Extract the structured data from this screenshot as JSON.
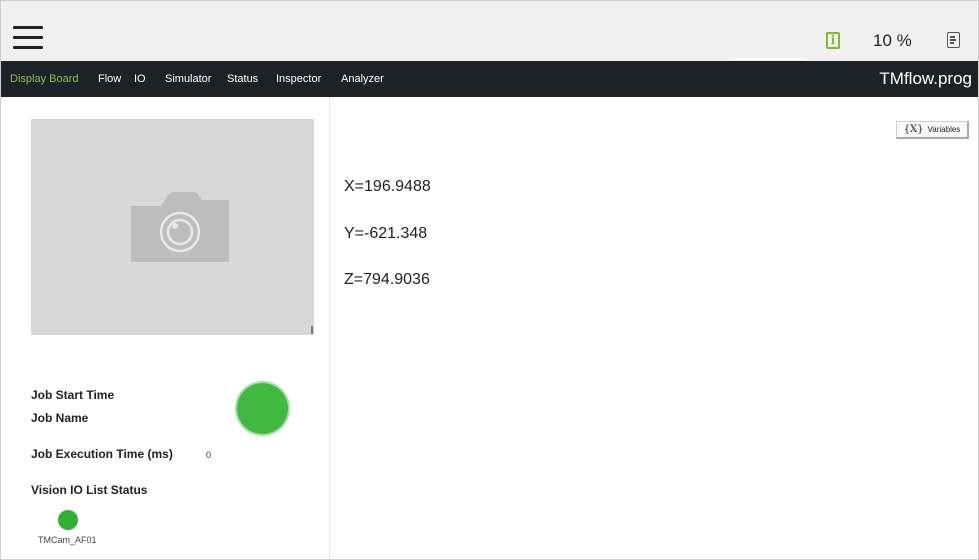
{
  "header": {
    "speed_percent": "10 %",
    "info_icon": "info-icon",
    "log_icon": "document-icon"
  },
  "nav": {
    "tabs": [
      {
        "label": "Display Board",
        "active": true
      },
      {
        "label": "Flow",
        "active": false
      },
      {
        "label": "IO",
        "active": false
      },
      {
        "label": "Simulator",
        "active": false
      },
      {
        "label": "Status",
        "active": false
      },
      {
        "label": "Inspector",
        "active": false
      },
      {
        "label": "Analyzer",
        "active": false
      }
    ],
    "file_name": "TMflow.prog"
  },
  "job": {
    "start_time_label": "Job Start Time",
    "name_label": "Job Name",
    "execution_time_label": "Job Execution Time (ms)",
    "execution_time_value": "0",
    "io_list_label": "Vision IO List Status",
    "io_device_name": "TMCam_AF01"
  },
  "display": {
    "variables_button": "Variables",
    "variables_icon_text": "{X}",
    "coords": [
      "X=196.9488",
      "Y=-621.348",
      "Z=794.9036"
    ]
  },
  "colors": {
    "accent_green": "#8cc63f",
    "status_green": "#3fb93f",
    "nav_bg": "#1b2228"
  }
}
